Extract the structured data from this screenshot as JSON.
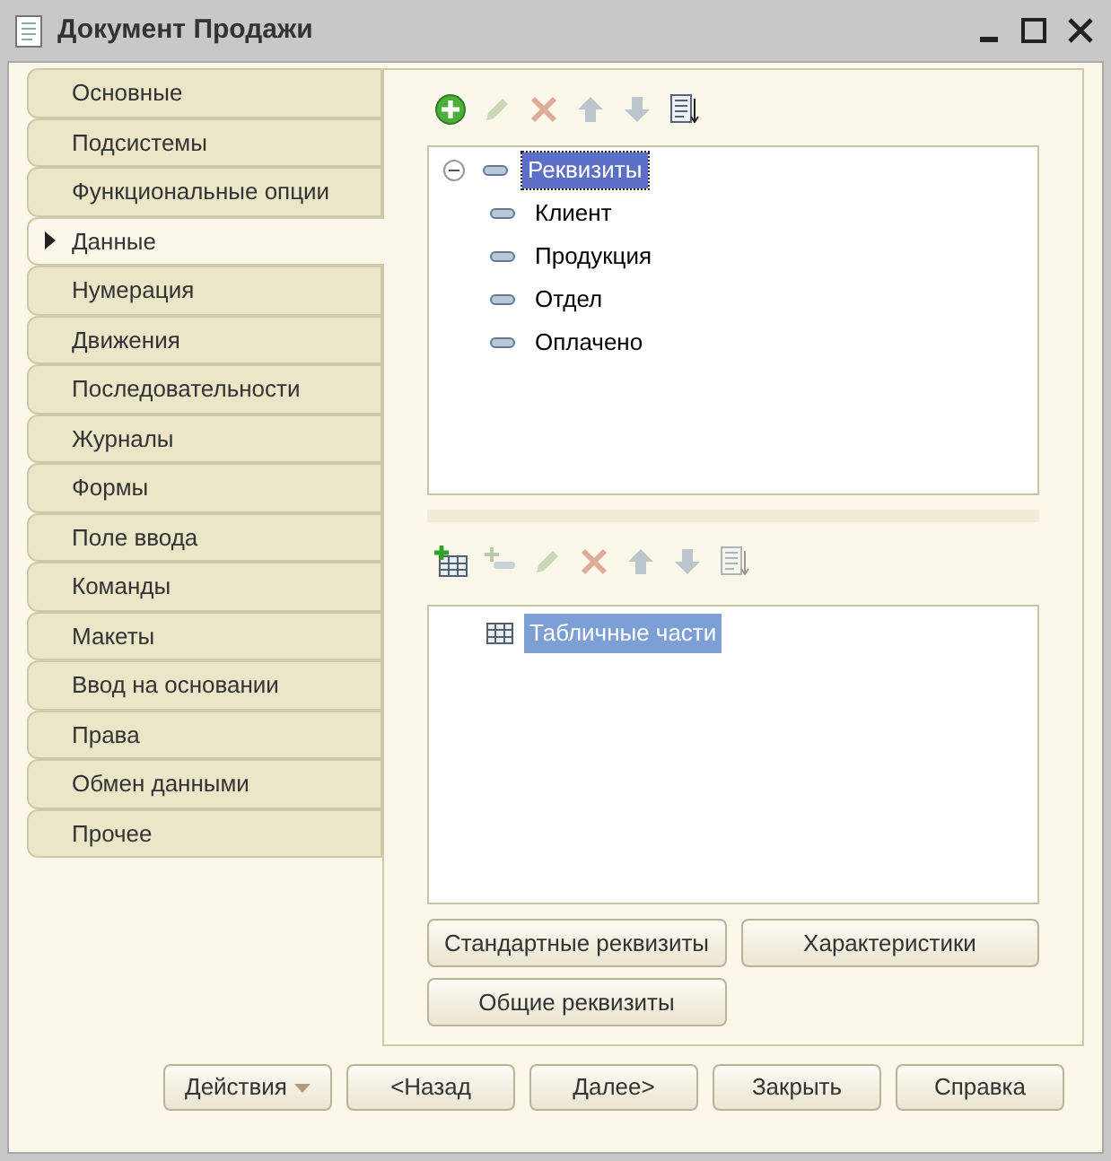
{
  "window": {
    "title": "Документ Продажи"
  },
  "tabs": [
    {
      "label": "Основные",
      "selected": false
    },
    {
      "label": "Подсистемы",
      "selected": false
    },
    {
      "label": "Функциональные опции",
      "selected": false
    },
    {
      "label": "Данные",
      "selected": true
    },
    {
      "label": "Нумерация",
      "selected": false
    },
    {
      "label": "Движения",
      "selected": false
    },
    {
      "label": "Последовательности",
      "selected": false
    },
    {
      "label": "Журналы",
      "selected": false
    },
    {
      "label": "Формы",
      "selected": false
    },
    {
      "label": "Поле ввода",
      "selected": false
    },
    {
      "label": "Команды",
      "selected": false
    },
    {
      "label": "Макеты",
      "selected": false
    },
    {
      "label": "Ввод на основании",
      "selected": false
    },
    {
      "label": "Права",
      "selected": false
    },
    {
      "label": "Обмен данными",
      "selected": false
    },
    {
      "label": "Прочее",
      "selected": false
    }
  ],
  "attributes_toolbar": [
    {
      "kind": "add",
      "disabled": false
    },
    {
      "kind": "edit",
      "disabled": true
    },
    {
      "kind": "delete",
      "disabled": true
    },
    {
      "kind": "up",
      "disabled": true
    },
    {
      "kind": "down",
      "disabled": true
    },
    {
      "kind": "sort",
      "disabled": false
    }
  ],
  "attributes_tree": [
    {
      "label": "Реквизиты",
      "selected": true,
      "expanded": true,
      "children": [
        {
          "label": "Клиент",
          "selected": false
        },
        {
          "label": "Продукция",
          "selected": false
        },
        {
          "label": "Отдел",
          "selected": false
        },
        {
          "label": "Оплачено",
          "selected": false
        }
      ]
    }
  ],
  "tables_toolbar": [
    {
      "kind": "add-table",
      "disabled": false
    },
    {
      "kind": "add-column",
      "disabled": true
    },
    {
      "kind": "edit",
      "disabled": true
    },
    {
      "kind": "delete",
      "disabled": true
    },
    {
      "kind": "up",
      "disabled": true
    },
    {
      "kind": "down",
      "disabled": true
    },
    {
      "kind": "sort",
      "disabled": true
    }
  ],
  "tables_tree": [
    {
      "label": "Табличные части",
      "selected": true
    }
  ],
  "panel_buttons": [
    "Стандартные реквизиты",
    "Характеристики",
    "Общие реквизиты"
  ],
  "footer": {
    "actions": "Действия",
    "buttons": [
      "<Назад",
      "Далее>",
      "Закрыть",
      "Справка"
    ]
  }
}
